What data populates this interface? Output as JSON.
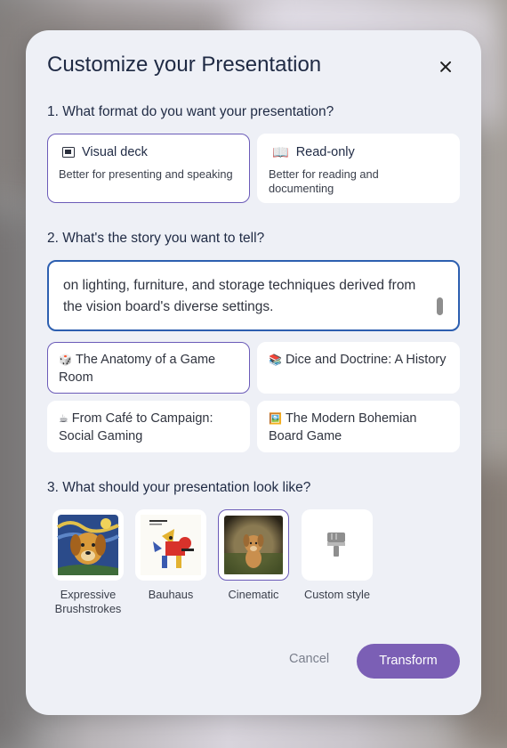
{
  "dialog": {
    "title": "Customize your Presentation",
    "close_icon": "close-icon"
  },
  "format": {
    "question": "1. What format do you want your presentation?",
    "options": [
      {
        "label": "Visual deck",
        "description": "Better for presenting and speaking",
        "icon": "slides-icon",
        "selected": true
      },
      {
        "label": "Read-only",
        "description": "Better for reading and documenting",
        "icon": "book-icon",
        "selected": false
      }
    ]
  },
  "story": {
    "question": "2. What's the story you want to tell?",
    "text": "on lighting, furniture, and storage techniques derived from the vision board's diverse settings.",
    "suggestions": [
      {
        "emoji": "🎲",
        "label": "The Anatomy of a Game Room",
        "selected": true
      },
      {
        "emoji": "📚",
        "label": "Dice and Doctrine: A History",
        "selected": false
      },
      {
        "emoji": "☕",
        "label": "From Café to Campaign: Social Gaming",
        "selected": false
      },
      {
        "emoji": "🖼️",
        "label": "The Modern Bohemian Board Game",
        "selected": false
      }
    ]
  },
  "look": {
    "question": "3. What should your presentation look like?",
    "styles": [
      {
        "label": "Expressive Brushstrokes",
        "selected": false
      },
      {
        "label": "Bauhaus",
        "selected": false
      },
      {
        "label": "Cinematic",
        "selected": true
      },
      {
        "label": "Custom style",
        "icon": "paint-roller-icon",
        "selected": false
      }
    ]
  },
  "actions": {
    "cancel": "Cancel",
    "transform": "Transform"
  },
  "colors": {
    "accent": "#7b5fb5",
    "selected_border": "#6b5bb8",
    "input_border": "#2d5fb0"
  }
}
